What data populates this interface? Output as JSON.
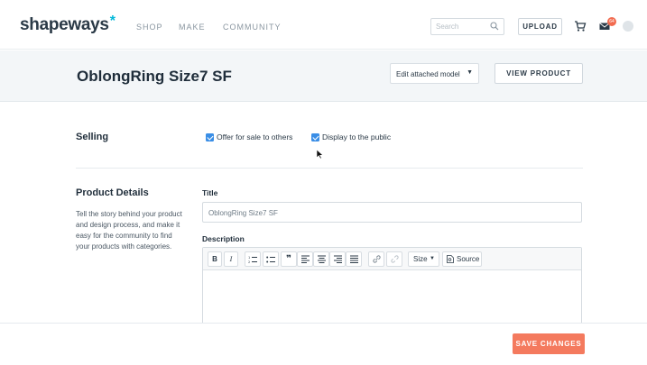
{
  "brand": {
    "name": "shapeways",
    "mark": "*",
    "accent": "#00b8d9"
  },
  "nav": {
    "items": [
      "SHOP",
      "MAKE",
      "COMMUNITY"
    ]
  },
  "search": {
    "placeholder": "Search"
  },
  "header_actions": {
    "upload_label": "UPLOAD",
    "notification_count": "64"
  },
  "product": {
    "title": "OblongRing Size7 SF",
    "model_select_value": "Edit attached model",
    "view_product_label": "VIEW PRODUCT"
  },
  "selling": {
    "label": "Selling",
    "offer_for_sale": {
      "label": "Offer for sale to others",
      "checked": true
    },
    "display_public": {
      "label": "Display to the public",
      "checked": true
    }
  },
  "details": {
    "label": "Product Details",
    "description": "Tell the story behind your product and design process, and make it easy for the community to find your products with categories.",
    "title_label": "Title",
    "title_value": "OblongRing Size7 SF",
    "description_label": "Description"
  },
  "editor_toolbar": {
    "bold": "B",
    "italic": "I",
    "size_label": "Size",
    "source_label": "Source"
  },
  "footer": {
    "save_label": "SAVE CHANGES",
    "save_color": "#f47a5e"
  }
}
